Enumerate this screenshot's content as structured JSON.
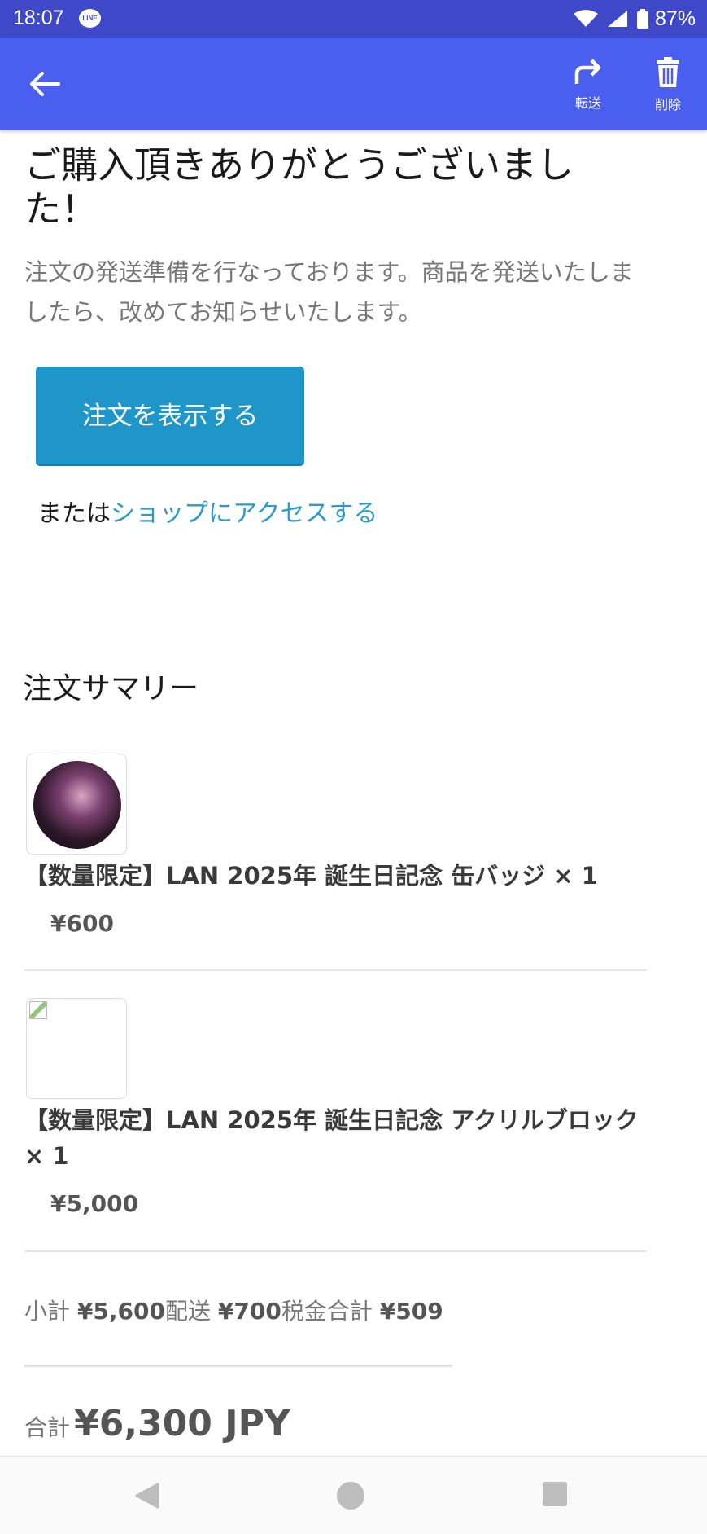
{
  "status_bar": {
    "time": "18:07",
    "notification_icon": "line-app-icon",
    "notification_text": "LINE",
    "battery": "87%"
  },
  "app_bar": {
    "forward_label": "転送",
    "delete_label": "削除",
    "color": "#4a5ef0"
  },
  "email": {
    "thanks_heading": "ご購入頂きありがとうございました！",
    "shipping_message": "注文の発送準備を行なっております。商品を発送いたしましたら、改めてお知らせいたします。",
    "view_order_button": "注文を表示する",
    "or_text": "または",
    "shop_link": "ショップにアクセスする",
    "summary_title": "注文サマリー"
  },
  "items": [
    {
      "title": "【数量限定】LAN 2025年 誕生日記念 缶バッジ",
      "qty": "× 1",
      "price": "¥600"
    },
    {
      "title": "【数量限定】LAN 2025年 誕生日記念 アクリルブロック",
      "qty": "× 1",
      "price": "¥5,000"
    }
  ],
  "totals": {
    "subtotal_label": "小計",
    "subtotal_value": "¥5,600",
    "shipping_label": "配送",
    "shipping_value": "¥700",
    "tax_label": "税金合計",
    "tax_value": "¥509",
    "total_label": "合計",
    "total_value": "¥6,300 JPY"
  },
  "colors": {
    "button": "#1e96c8",
    "link": "#2a9bd0",
    "status_bar": "#3f48c9"
  }
}
